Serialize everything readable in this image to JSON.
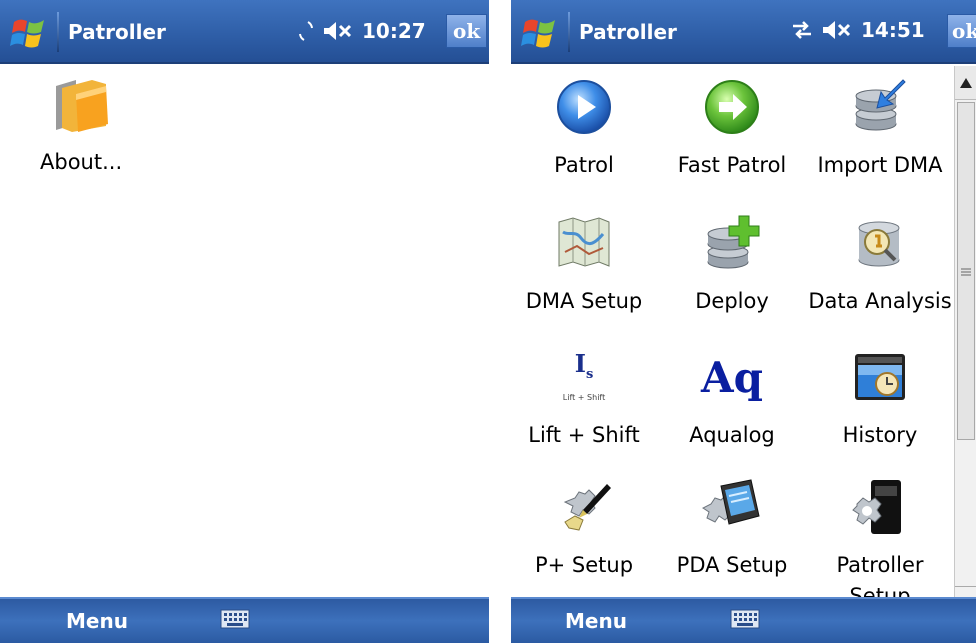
{
  "left": {
    "title": "Patroller",
    "time": "10:27",
    "ok_label": "ok",
    "menu_label": "Menu",
    "items": [
      {
        "label": "About...",
        "icon": "folder-icon"
      }
    ]
  },
  "right": {
    "title": "Patroller",
    "time": "14:51",
    "ok_label": "ok",
    "menu_label": "Menu",
    "tiles": [
      {
        "label": "Patrol",
        "icon": "play-icon"
      },
      {
        "label": "Fast Patrol",
        "icon": "forward-arrow-icon"
      },
      {
        "label": "Import DMA",
        "icon": "database-import-icon"
      },
      {
        "label": "DMA Setup",
        "icon": "map-icon"
      },
      {
        "label": "Deploy",
        "icon": "database-add-icon"
      },
      {
        "label": "Data Analysis",
        "icon": "database-search-icon"
      },
      {
        "label": "Lift + Shift",
        "icon": "lift-shift-icon"
      },
      {
        "label": "Aqualog",
        "icon": "aqualog-icon"
      },
      {
        "label": "History",
        "icon": "history-folder-icon"
      },
      {
        "label": "P+ Setup",
        "icon": "gear-pen-icon"
      },
      {
        "label": "PDA Setup",
        "icon": "gear-pda-icon"
      },
      {
        "label": "Patroller Setup",
        "icon": "gear-device-icon"
      }
    ],
    "lift_shift_icon_text": "Lift + Shift",
    "aqualog_icon_text": "Aq"
  }
}
